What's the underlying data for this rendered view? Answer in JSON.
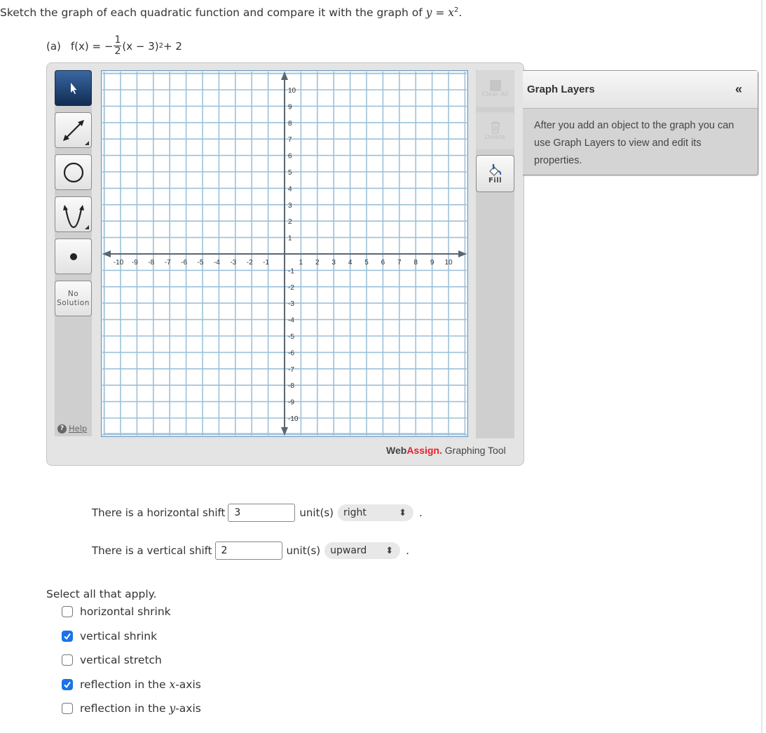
{
  "question": {
    "prompt_prefix": "Sketch the graph of each quadratic function and compare it with the graph of ",
    "prompt_math_y": "y",
    "prompt_math_eq": " = ",
    "prompt_math_x": "x",
    "prompt_math_exp": "2",
    "prompt_suffix": ".",
    "part_label": "(a)",
    "function_lhs": "f(x) = −",
    "fraction_num": "1",
    "fraction_den": "2",
    "function_rhs": "(x − 3)",
    "function_exp": "2",
    "function_tail": " + 2"
  },
  "graphing_tool": {
    "left_tools": [
      {
        "name": "pointer",
        "icon": "pointer-icon",
        "active": true
      },
      {
        "name": "line",
        "icon": "line-icon",
        "active": false
      },
      {
        "name": "circle",
        "icon": "circle-icon",
        "active": false
      },
      {
        "name": "parabola",
        "icon": "parabola-icon",
        "active": false
      },
      {
        "name": "point",
        "icon": "point-icon",
        "active": false
      }
    ],
    "no_solution_line1": "No",
    "no_solution_line2": "Solution",
    "help_label": "Help",
    "right_tools": {
      "clear_all": "Clear All",
      "delete": "Delete",
      "fill": "Fill"
    },
    "brand_web": "Web",
    "brand_assign": "Assign.",
    "brand_rest": " Graphing Tool",
    "graph": {
      "x_range": [
        -10,
        10
      ],
      "y_range": [
        -10,
        10
      ],
      "x_ticks": [
        "-10",
        "-9",
        "-8",
        "-7",
        "-6",
        "-5",
        "-4",
        "-3",
        "-2",
        "-1",
        "1",
        "2",
        "3",
        "4",
        "5",
        "6",
        "7",
        "8",
        "9",
        "10"
      ],
      "y_ticks": [
        "10",
        "9",
        "8",
        "7",
        "6",
        "5",
        "4",
        "3",
        "2",
        "1",
        "-1",
        "-2",
        "-3",
        "-4",
        "-5",
        "-6",
        "-7",
        "-8",
        "-9",
        "-10"
      ],
      "grid_color": "#9cc1d9",
      "axis_color": "#5b6670"
    }
  },
  "graph_layers": {
    "title": "Graph Layers",
    "collapse": "«",
    "body": "After you add an object to the graph you can use Graph Layers to view and edit its properties."
  },
  "answers": {
    "horizontal": {
      "prefix": "There is a horizontal shift",
      "value": "3",
      "units": "unit(s)",
      "direction": "right",
      "suffix": "."
    },
    "vertical": {
      "prefix": "There is a vertical shift",
      "value": "2",
      "units": "unit(s)",
      "direction": "upward",
      "suffix": "."
    },
    "select_all_label": "Select all that apply.",
    "options": [
      {
        "label": "horizontal shrink",
        "checked": false
      },
      {
        "label": "vertical shrink",
        "checked": true
      },
      {
        "label": "vertical stretch",
        "checked": false
      },
      {
        "label_prefix": "reflection in the ",
        "label_var": "x",
        "label_suffix": "-axis",
        "checked": true
      },
      {
        "label_prefix": "reflection in the ",
        "label_var": "y",
        "label_suffix": "-axis",
        "checked": false
      }
    ],
    "checkbox_color": "#1a73e8"
  }
}
